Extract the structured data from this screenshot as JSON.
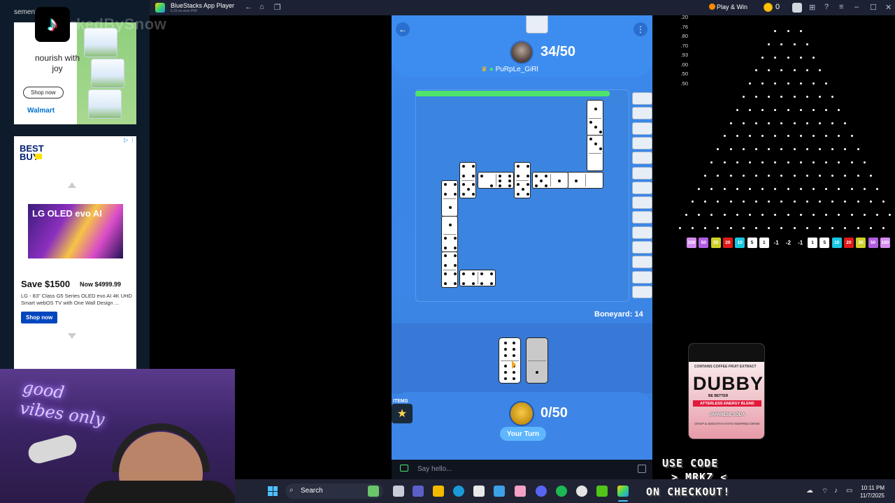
{
  "left_ads": {
    "header": "sement ⓘ",
    "watermark": "rkedBySnow",
    "ad1": {
      "headline": "nourish with joy",
      "cta": "Shop now",
      "brand": "Walmart"
    },
    "ad2": {
      "brand": "BEST BUY",
      "tv_brand": "LG OLED evo AI",
      "save": "Save $1500",
      "price": "Now $4999.99",
      "description": "LG - 83\" Class G5 Series OLED evo AI 4K UHD Smart webOS TV with One Wall Design ...",
      "cta": "Shop now"
    },
    "webcam_sign": "good vibes only"
  },
  "titlebar": {
    "app_title": "BlueStacks App Player",
    "version": "5.22.xx.xxxx P64",
    "play_win": "Play & Win",
    "coins": "0"
  },
  "game": {
    "opponent": {
      "name": "PuRpLe_GiRl",
      "score": "34/50"
    },
    "boneyard": "Boneyard: 14",
    "player": {
      "score": "0/50",
      "turn": "Your Turn"
    },
    "items_label": "ITEMS",
    "chat_placeholder": "Say hello...",
    "side_tiles": 14,
    "progress": 0.92
  },
  "plinko": {
    "multipliers": [
      ".20",
      ".76",
      ".80",
      ".70",
      ".93",
      ".00",
      ".50",
      ".50"
    ],
    "buckets": [
      {
        "label": "100",
        "color": "#d58cf0"
      },
      {
        "label": "50",
        "color": "#b15de0"
      },
      {
        "label": "35",
        "color": "#cfcf2a"
      },
      {
        "label": "20",
        "color": "#e01919"
      },
      {
        "label": "10",
        "color": "#19c7e0"
      },
      {
        "label": "5",
        "color": "#ffffff"
      },
      {
        "label": "1",
        "color": "#ffffff"
      },
      {
        "label": "-1",
        "color": ""
      },
      {
        "label": "-2",
        "color": ""
      },
      {
        "label": "-1",
        "color": ""
      },
      {
        "label": "1",
        "color": "#ffffff"
      },
      {
        "label": "5",
        "color": "#ffffff"
      },
      {
        "label": "10",
        "color": "#19c7e0"
      },
      {
        "label": "20",
        "color": "#e01919"
      },
      {
        "label": "35",
        "color": "#cfcf2a"
      },
      {
        "label": "50",
        "color": "#b15de0"
      },
      {
        "label": "100",
        "color": "#d58cf0"
      }
    ]
  },
  "sponsor": {
    "top_text": "CONTAINS COFFEE FRUIT EXTRACT",
    "name": "DUBBY",
    "tagline": "BE BETTER",
    "band": "ATTERLESS ENERGY BLEND",
    "flavor": "JAPANESE SODA",
    "small": "CRISP & SMOOTH KYOTO-INSPIRED DRINK",
    "promo_lines": [
      "USE CODE",
      "> MRKZ <",
      "ON CHECKOUT!"
    ]
  },
  "taskbar": {
    "search_label": "Search",
    "time": "10:11 PM",
    "date": "11/7/2025"
  }
}
